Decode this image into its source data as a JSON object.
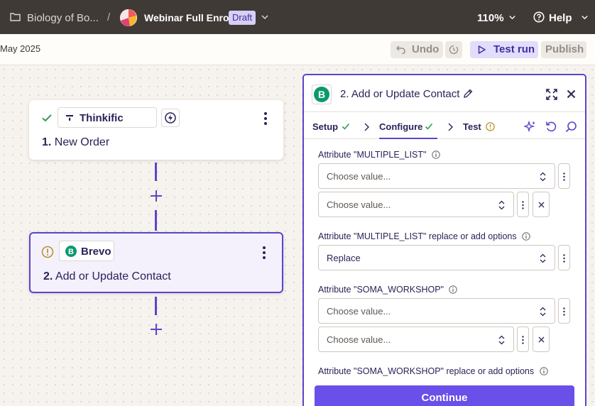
{
  "topbar": {
    "folder_name": "Biology of Bo...",
    "separator": "/",
    "zap_title": "Webinar Full Enrol",
    "status_badge": "Draft",
    "zoom": "110%",
    "help_label": "Help"
  },
  "subbar": {
    "date_text": "May 2025",
    "undo_label": "Undo",
    "test_run_label": "Test run",
    "publish_label": "Publish"
  },
  "canvas": {
    "steps": [
      {
        "number": "1.",
        "title": "New Order",
        "app": "Thinkific",
        "status": "success"
      },
      {
        "number": "2.",
        "title": "Add or Update Contact",
        "app": "Brevo",
        "status": "warning"
      }
    ]
  },
  "panel": {
    "title": "2. Add or Update Contact",
    "tabs": [
      {
        "label": "Setup",
        "status": "complete"
      },
      {
        "label": "Configure",
        "status": "complete"
      },
      {
        "label": "Test",
        "status": "warning"
      }
    ],
    "fields": [
      {
        "label": "Attribute \"MULTIPLE_LIST\"",
        "values": [
          "Choose value...",
          "Choose value..."
        ]
      },
      {
        "label": "Attribute \"MULTIPLE_LIST\" replace or add options",
        "values": [
          "Replace"
        ]
      },
      {
        "label": "Attribute \"SOMA_WORKSHOP\"",
        "values": [
          "Choose value...",
          "Choose value..."
        ]
      },
      {
        "label": "Attribute \"SOMA_WORKSHOP\" replace or add options",
        "values": []
      }
    ],
    "continue_label": "Continue"
  },
  "colors": {
    "topbar_bg": "#403a37",
    "accent": "#5b45c9",
    "continue_bg": "#6a4fe8",
    "success": "#2e9e55",
    "warning": "#b7952b",
    "brevo": "#0b996e"
  },
  "icons": {
    "folder": "folder-icon",
    "help": "help-circle-icon",
    "undo": "undo-icon",
    "history": "history-icon",
    "play": "play-icon",
    "check": "check-icon",
    "warning": "warning-circle-icon",
    "lightning": "lightning-icon",
    "kebab": "kebab-icon",
    "plus": "plus-icon",
    "pencil": "pencil-icon",
    "expand": "expand-icon",
    "close": "close-icon",
    "sparkle": "sparkle-icon",
    "refresh": "refresh-icon",
    "search": "search-icon",
    "info": "info-icon"
  }
}
